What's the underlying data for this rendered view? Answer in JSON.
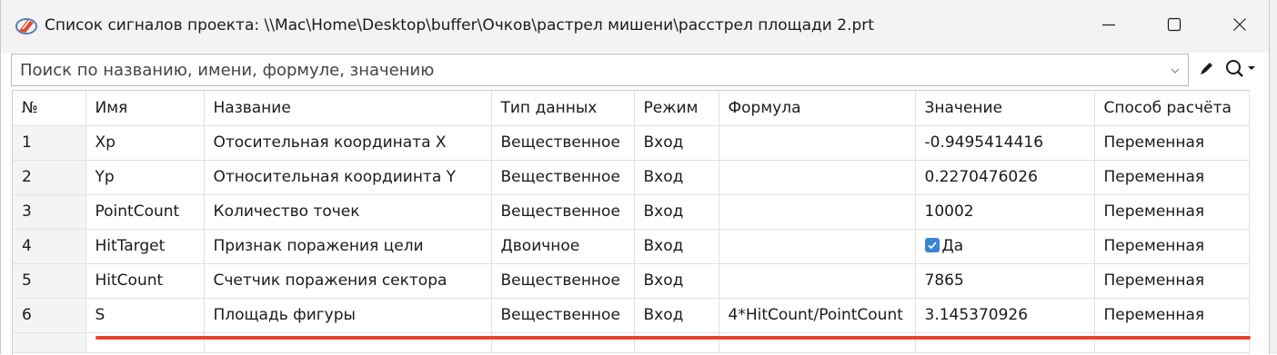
{
  "window": {
    "title": "Список сигналов проекта: \\\\Mac\\Home\\Desktop\\buffer\\Очков\\растрел мишени\\расстрел площади 2.prt",
    "icons": {
      "app": "app-logo-icon",
      "minimize": "minimize-icon",
      "maximize": "maximize-icon",
      "close": "close-icon"
    }
  },
  "search": {
    "placeholder": "Поиск по названию, имени, формуле, значению",
    "value": "",
    "icons": {
      "dropdown": "chevron-down-icon",
      "edit": "pencil-icon",
      "search": "search-icon"
    }
  },
  "table": {
    "columns": [
      "№",
      "Имя",
      "Название",
      "Тип данных",
      "Режим",
      "Формула",
      "Значение",
      "Способ расчёта"
    ],
    "rows": [
      {
        "num": "1",
        "name": "Xp",
        "title": "Отосительная координата X",
        "type": "Вещественное",
        "mode": "Вход",
        "formula": "",
        "value": "-0.9495414416",
        "method": "Переменная"
      },
      {
        "num": "2",
        "name": "Yp",
        "title": "Относительная коордиинта Y",
        "type": "Вещественное",
        "mode": "Вход",
        "formula": "",
        "value": "0.2270476026",
        "method": "Переменная"
      },
      {
        "num": "3",
        "name": "PointCount",
        "title": "Количество точек",
        "type": "Вещественное",
        "mode": "Вход",
        "formula": "",
        "value": "10002",
        "method": "Переменная"
      },
      {
        "num": "4",
        "name": "HitTarget",
        "title": "Признак поражения цели",
        "type": "Двоичное",
        "mode": "Вход",
        "formula": "",
        "value": "Да",
        "checked": true,
        "method": "Переменная"
      },
      {
        "num": "5",
        "name": "HitCount",
        "title": "Счетчик поражения сектора",
        "type": "Вещественное",
        "mode": "Вход",
        "formula": "",
        "value": "7865",
        "method": "Переменная"
      },
      {
        "num": "6",
        "name": "S",
        "title": "Площадь фигуры",
        "type": "Вещественное",
        "mode": "Вход",
        "formula": "4*HitCount/PointCount",
        "value": "3.145370926",
        "method": "Переменная"
      }
    ]
  },
  "colors": {
    "accent_checkbox": "#3b82d6",
    "highlight_underline": "#e8412c",
    "titlebar_bg": "#f3f3f3"
  }
}
